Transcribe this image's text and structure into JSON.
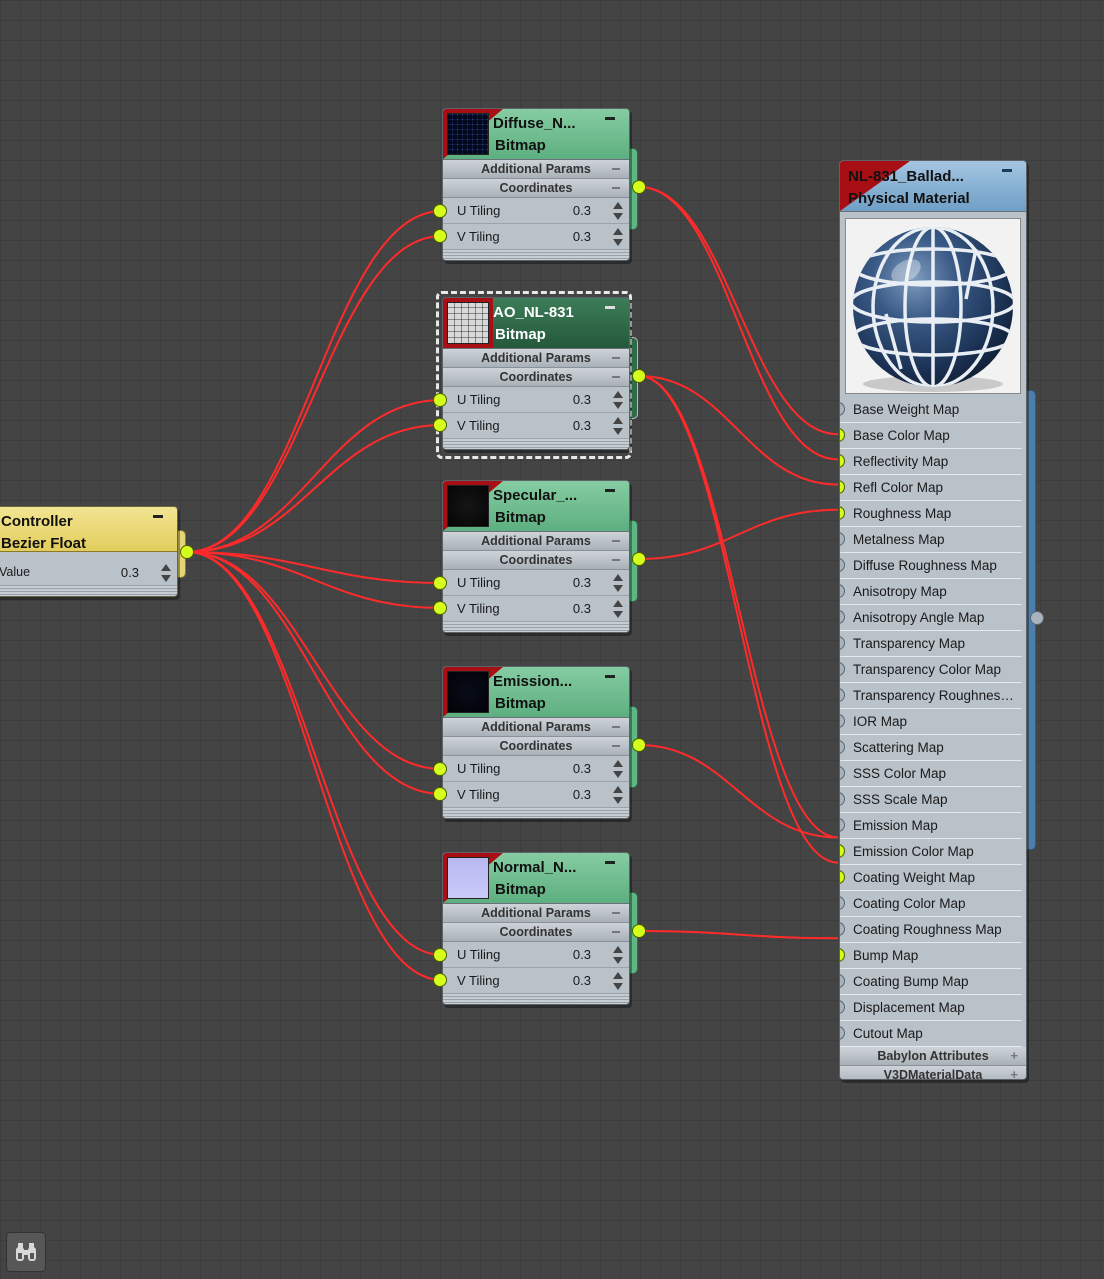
{
  "controller": {
    "title1": "Controller",
    "title2": "Bezier Float",
    "row_label": "Value",
    "row_value": "0.3"
  },
  "bitmap_nodes": [
    {
      "title1": "Diffuse_N...",
      "title2": "Bitmap",
      "sections": [
        "Additional Params",
        "Coordinates"
      ],
      "rows": [
        {
          "label": "U Tiling",
          "value": "0.3"
        },
        {
          "label": "V Tiling",
          "value": "0.3"
        }
      ]
    },
    {
      "title1": "AO_NL-831",
      "title2": "Bitmap",
      "sections": [
        "Additional Params",
        "Coordinates"
      ],
      "rows": [
        {
          "label": "U Tiling",
          "value": "0.3"
        },
        {
          "label": "V Tiling",
          "value": "0.3"
        }
      ]
    },
    {
      "title1": "Specular_...",
      "title2": "Bitmap",
      "sections": [
        "Additional Params",
        "Coordinates"
      ],
      "rows": [
        {
          "label": "U Tiling",
          "value": "0.3"
        },
        {
          "label": "V Tiling",
          "value": "0.3"
        }
      ]
    },
    {
      "title1": "Emission...",
      "title2": "Bitmap",
      "sections": [
        "Additional Params",
        "Coordinates"
      ],
      "rows": [
        {
          "label": "U Tiling",
          "value": "0.3"
        },
        {
          "label": "V Tiling",
          "value": "0.3"
        }
      ]
    },
    {
      "title1": "Normal_N...",
      "title2": "Bitmap",
      "sections": [
        "Additional Params",
        "Coordinates"
      ],
      "rows": [
        {
          "label": "U Tiling",
          "value": "0.3"
        },
        {
          "label": "V Tiling",
          "value": "0.3"
        }
      ]
    }
  ],
  "material": {
    "title1": "NL-831_Ballad...",
    "title2": "Physical Material",
    "slots": [
      "Base Weight Map",
      "Base Color Map",
      "Reflectivity Map",
      "Refl Color Map",
      "Roughness Map",
      "Metalness Map",
      "Diffuse Roughness Map",
      "Anisotropy Map",
      "Anisotropy Angle Map",
      "Transparency Map",
      "Transparency Color Map",
      "Transparency  Roughness...",
      "IOR Map",
      "Scattering Map",
      "SSS Color Map",
      "SSS Scale Map",
      "Emission Map",
      "Emission Color Map",
      "Coating Weight Map",
      "Coating Color Map",
      "Coating Roughness Map",
      "Bump Map",
      "Coating Bump Map",
      "Displacement Map",
      "Cutout Map"
    ],
    "sections": [
      "Babylon Attributes",
      "V3DMaterialData"
    ]
  },
  "colors": {
    "wire": "#ff2a2a",
    "port_active": "#d4ff1c",
    "port_inactive": "#a9b3bd",
    "bitmap_header": "#6dbb8d",
    "bitmap_header_selected": "#2e6b48",
    "red_flag": "#a80f14",
    "material_header": "#8db7d8",
    "controller_header": "#e8d46c"
  },
  "icons": {
    "bottom_left": "binoculars-icon"
  }
}
